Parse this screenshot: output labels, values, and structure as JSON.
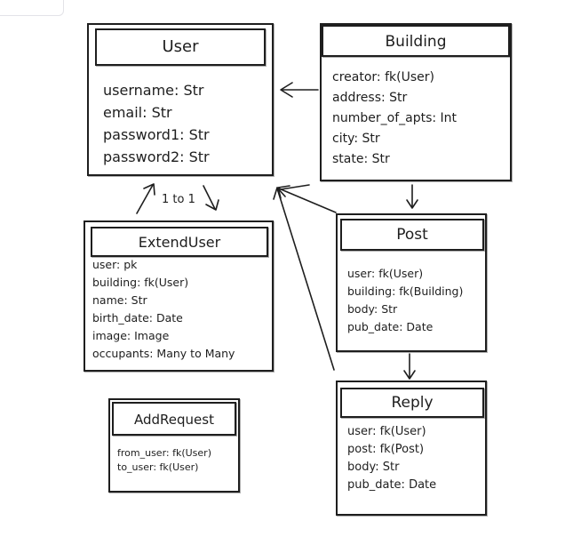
{
  "entities": {
    "user": {
      "title": "User",
      "fields": [
        "username: Str",
        "email: Str",
        "password1: Str",
        "password2: Str"
      ]
    },
    "building": {
      "title": "Building",
      "fields": [
        "creator: fk(User)",
        "address: Str",
        "number_of_apts: Int",
        "city: Str",
        "state: Str"
      ]
    },
    "extend_user": {
      "title": "ExtendUser",
      "fields": [
        "user: pk",
        "building: fk(User)",
        "name: Str",
        "birth_date: Date",
        "image: Image",
        "occupants: Many to Many"
      ]
    },
    "post": {
      "title": "Post",
      "fields": [
        "user: fk(User)",
        "building: fk(Building)",
        "body: Str",
        "pub_date: Date"
      ]
    },
    "reply": {
      "title": "Reply",
      "fields": [
        "user: fk(User)",
        "post: fk(Post)",
        "body: Str",
        "pub_date: Date"
      ]
    },
    "add_request": {
      "title": "AddRequest",
      "fields": [
        "from_user: fk(User)",
        "to_user: fk(User)"
      ]
    }
  },
  "relations": {
    "user_extenduser": "1 to 1"
  },
  "colors": {
    "ink": "#1e1e1e",
    "background": "#ffffff"
  }
}
